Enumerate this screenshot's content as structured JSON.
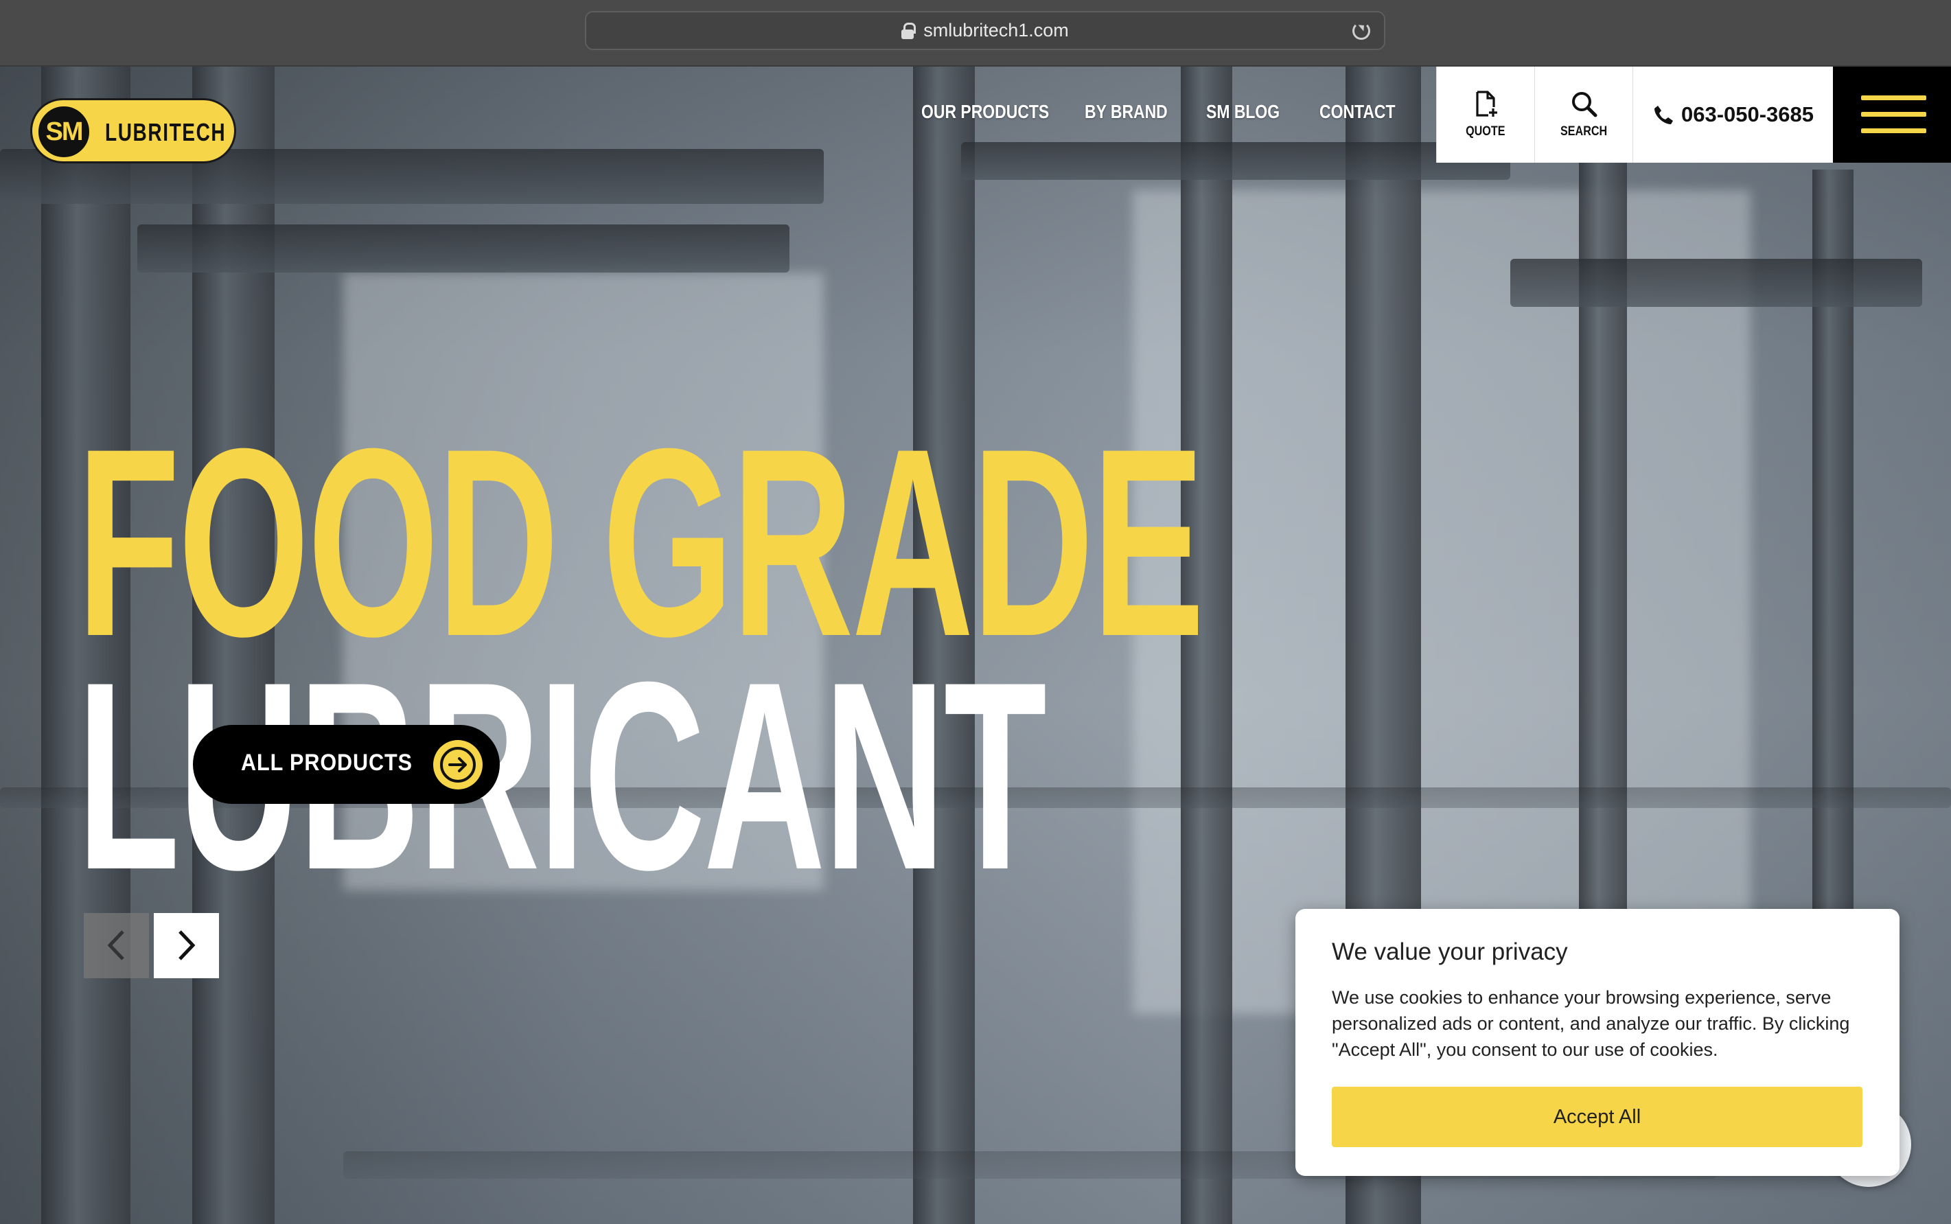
{
  "browser": {
    "url": "smlubritech1.com"
  },
  "header": {
    "logo_mark": "SM",
    "logo_name": "LUBRITECH",
    "nav": [
      "OUR PRODUCTS",
      "BY BRAND",
      "SM BLOG",
      "CONTACT"
    ],
    "quote_label": "QUOTE",
    "search_label": "SEARCH",
    "phone": "063-050-3685"
  },
  "hero": {
    "headline_line1": "FOOD GRADE",
    "headline_line2": "LUBRICANT",
    "cta_label": "ALL PRODUCTS"
  },
  "cookie_banner": {
    "title": "We value your privacy",
    "body": "We use cookies to enhance your browsing experience, serve personalized ads or content, and analyze our traffic. By clicking \"Accept All\", you consent to our use of cookies.",
    "accept_label": "Accept All"
  },
  "colors": {
    "brand_yellow": "#f7d548",
    "black": "#000000",
    "white": "#ffffff"
  },
  "icons": [
    "lock-icon",
    "reload-icon",
    "quote-icon",
    "search-icon",
    "phone-icon",
    "hamburger-menu-icon",
    "arrow-right-icon",
    "chevron-left-icon",
    "chevron-right-icon",
    "chat-icon"
  ]
}
